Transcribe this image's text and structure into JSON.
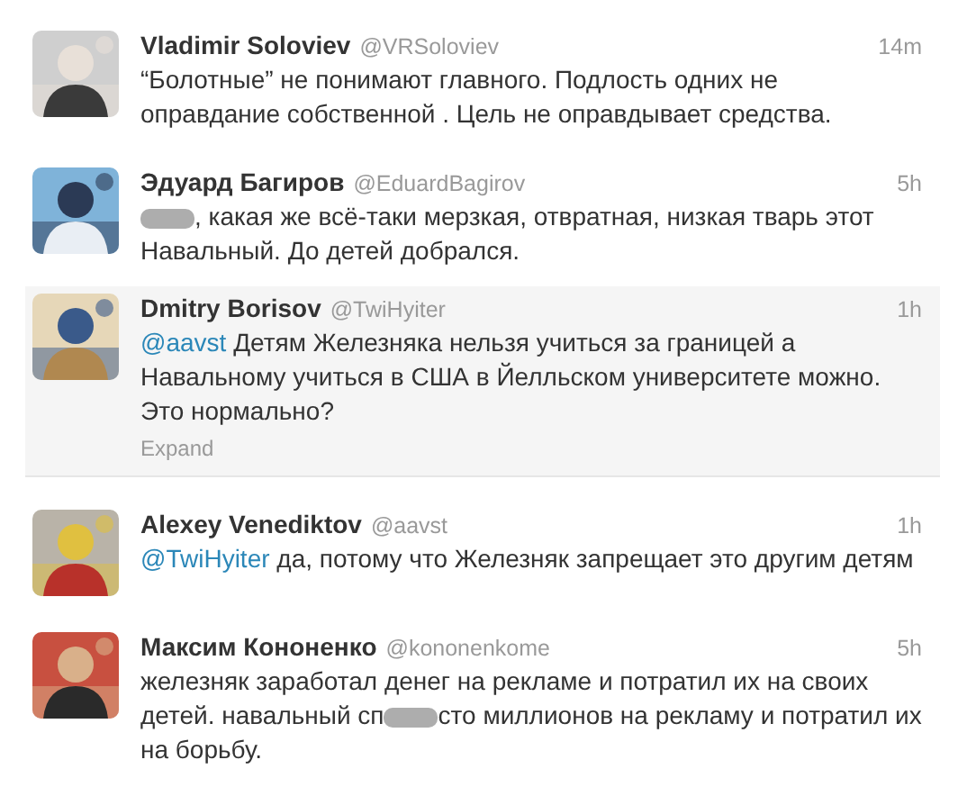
{
  "tweets": [
    {
      "avatar": {
        "kind": "picture"
      },
      "name": "Vladimir Soloviev",
      "handle": "@VRSoloviev",
      "time": "14m",
      "selected": false,
      "body": [
        {
          "kind": "text",
          "text": "“Болотные” не понимают главного. Подлость одних не оправдание собственной . Цель не оправдывает средства."
        }
      ]
    },
    {
      "avatar": {
        "kind": "picture"
      },
      "name": "Эдуард Багиров",
      "handle": "@EduardBagirov",
      "time": "5h",
      "selected": false,
      "body": [
        {
          "kind": "redaction"
        },
        {
          "kind": "text",
          "text": ", какая же всё-таки мерзкая, отвратная, низкая тварь этот Навальный. До детей добрался."
        }
      ]
    },
    {
      "avatar": {
        "kind": "picture"
      },
      "name": "Dmitry Borisov",
      "handle": "@TwiHyiter",
      "time": "1h",
      "selected": true,
      "body": [
        {
          "kind": "mention",
          "text": "@aavst"
        },
        {
          "kind": "text",
          "text": " Детям Железняка нельзя учиться за границей а Навальному учиться в США в Йелльском университете можно. Это нормально?"
        }
      ],
      "expand": "Expand"
    },
    {
      "avatar": {
        "kind": "picture"
      },
      "name": "Alexey Venediktov",
      "handle": "@aavst",
      "time": "1h",
      "selected": false,
      "body": [
        {
          "kind": "mention",
          "text": "@TwiHyiter"
        },
        {
          "kind": "text",
          "text": " да, потому что Железняк запрещает это другим детям"
        }
      ]
    },
    {
      "avatar": {
        "kind": "picture"
      },
      "name": "Максим Кононенко",
      "handle": "@kononenkome",
      "time": "5h",
      "selected": false,
      "body": [
        {
          "kind": "text",
          "text": "железняк заработал денег на рекламе и потратил их на своих детей. навальный сп"
        },
        {
          "kind": "redaction"
        },
        {
          "kind": "text",
          "text": "сто миллионов на рекламу и потратил их на борьбу."
        }
      ]
    }
  ]
}
